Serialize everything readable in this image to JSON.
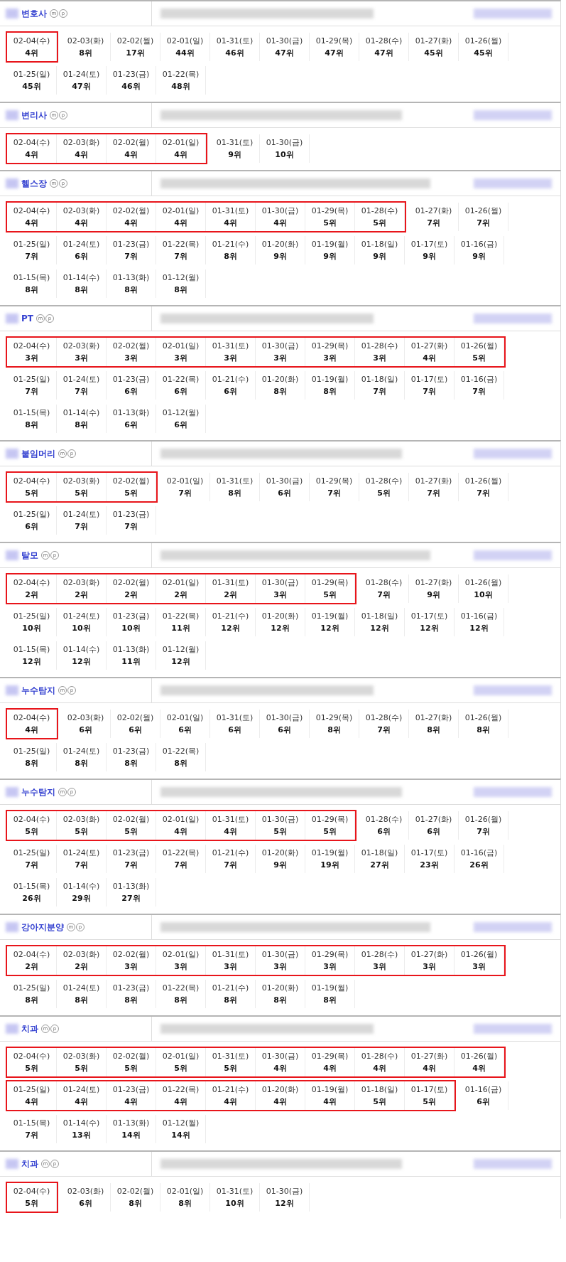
{
  "sections": [
    {
      "keyword": "변호사",
      "badges": [
        "m",
        "p"
      ],
      "rows": [
        [
          {
            "highlighted": true,
            "cells": [
              {
                "date": "02-04(수)",
                "rank": "4위"
              }
            ]
          },
          {
            "highlighted": false,
            "cells": [
              {
                "date": "02-03(화)",
                "rank": "8위"
              },
              {
                "date": "02-02(월)",
                "rank": "17위"
              },
              {
                "date": "02-01(일)",
                "rank": "44위"
              },
              {
                "date": "01-31(토)",
                "rank": "46위"
              },
              {
                "date": "01-30(금)",
                "rank": "47위"
              },
              {
                "date": "01-29(목)",
                "rank": "47위"
              },
              {
                "date": "01-28(수)",
                "rank": "47위"
              },
              {
                "date": "01-27(화)",
                "rank": "45위"
              },
              {
                "date": "01-26(월)",
                "rank": "45위"
              }
            ]
          }
        ],
        [
          {
            "highlighted": false,
            "cells": [
              {
                "date": "01-25(일)",
                "rank": "45위"
              },
              {
                "date": "01-24(토)",
                "rank": "47위"
              },
              {
                "date": "01-23(금)",
                "rank": "46위"
              },
              {
                "date": "01-22(목)",
                "rank": "48위"
              }
            ]
          }
        ]
      ]
    },
    {
      "keyword": "변리사",
      "badges": [
        "m",
        "p"
      ],
      "rows": [
        [
          {
            "highlighted": true,
            "cells": [
              {
                "date": "02-04(수)",
                "rank": "4위"
              },
              {
                "date": "02-03(화)",
                "rank": "4위"
              },
              {
                "date": "02-02(월)",
                "rank": "4위"
              },
              {
                "date": "02-01(일)",
                "rank": "4위"
              }
            ]
          },
          {
            "highlighted": false,
            "cells": [
              {
                "date": "01-31(토)",
                "rank": "9위"
              },
              {
                "date": "01-30(금)",
                "rank": "10위"
              }
            ]
          }
        ]
      ]
    },
    {
      "keyword": "헬스장",
      "badges": [
        "m",
        "p"
      ],
      "rows": [
        [
          {
            "highlighted": true,
            "cells": [
              {
                "date": "02-04(수)",
                "rank": "4위"
              },
              {
                "date": "02-03(화)",
                "rank": "4위"
              },
              {
                "date": "02-02(월)",
                "rank": "4위"
              },
              {
                "date": "02-01(일)",
                "rank": "4위"
              },
              {
                "date": "01-31(토)",
                "rank": "4위"
              },
              {
                "date": "01-30(금)",
                "rank": "4위"
              },
              {
                "date": "01-29(목)",
                "rank": "5위"
              },
              {
                "date": "01-28(수)",
                "rank": "5위"
              }
            ]
          },
          {
            "highlighted": false,
            "cells": [
              {
                "date": "01-27(화)",
                "rank": "7위"
              },
              {
                "date": "01-26(월)",
                "rank": "7위"
              }
            ]
          }
        ],
        [
          {
            "highlighted": false,
            "cells": [
              {
                "date": "01-25(일)",
                "rank": "7위"
              },
              {
                "date": "01-24(토)",
                "rank": "6위"
              },
              {
                "date": "01-23(금)",
                "rank": "7위"
              },
              {
                "date": "01-22(목)",
                "rank": "7위"
              },
              {
                "date": "01-21(수)",
                "rank": "8위"
              },
              {
                "date": "01-20(화)",
                "rank": "9위"
              },
              {
                "date": "01-19(월)",
                "rank": "9위"
              },
              {
                "date": "01-18(일)",
                "rank": "9위"
              },
              {
                "date": "01-17(토)",
                "rank": "9위"
              },
              {
                "date": "01-16(금)",
                "rank": "9위"
              }
            ]
          }
        ],
        [
          {
            "highlighted": false,
            "cells": [
              {
                "date": "01-15(목)",
                "rank": "8위"
              },
              {
                "date": "01-14(수)",
                "rank": "8위"
              },
              {
                "date": "01-13(화)",
                "rank": "8위"
              },
              {
                "date": "01-12(월)",
                "rank": "8위"
              }
            ]
          }
        ]
      ]
    },
    {
      "keyword": "PT",
      "badges": [
        "m",
        "p"
      ],
      "rows": [
        [
          {
            "highlighted": true,
            "cells": [
              {
                "date": "02-04(수)",
                "rank": "3위"
              },
              {
                "date": "02-03(화)",
                "rank": "3위"
              },
              {
                "date": "02-02(월)",
                "rank": "3위"
              },
              {
                "date": "02-01(일)",
                "rank": "3위"
              },
              {
                "date": "01-31(토)",
                "rank": "3위"
              },
              {
                "date": "01-30(금)",
                "rank": "3위"
              },
              {
                "date": "01-29(목)",
                "rank": "3위"
              },
              {
                "date": "01-28(수)",
                "rank": "3위"
              },
              {
                "date": "01-27(화)",
                "rank": "4위"
              },
              {
                "date": "01-26(월)",
                "rank": "5위"
              }
            ]
          }
        ],
        [
          {
            "highlighted": false,
            "cells": [
              {
                "date": "01-25(일)",
                "rank": "7위"
              },
              {
                "date": "01-24(토)",
                "rank": "7위"
              },
              {
                "date": "01-23(금)",
                "rank": "6위"
              },
              {
                "date": "01-22(목)",
                "rank": "6위"
              },
              {
                "date": "01-21(수)",
                "rank": "6위"
              },
              {
                "date": "01-20(화)",
                "rank": "8위"
              },
              {
                "date": "01-19(월)",
                "rank": "8위"
              },
              {
                "date": "01-18(일)",
                "rank": "7위"
              },
              {
                "date": "01-17(토)",
                "rank": "7위"
              },
              {
                "date": "01-16(금)",
                "rank": "7위"
              }
            ]
          }
        ],
        [
          {
            "highlighted": false,
            "cells": [
              {
                "date": "01-15(목)",
                "rank": "8위"
              },
              {
                "date": "01-14(수)",
                "rank": "8위"
              },
              {
                "date": "01-13(화)",
                "rank": "6위"
              },
              {
                "date": "01-12(월)",
                "rank": "6위"
              }
            ]
          }
        ]
      ]
    },
    {
      "keyword": "붙임머리",
      "badges": [
        "m",
        "p"
      ],
      "rows": [
        [
          {
            "highlighted": true,
            "cells": [
              {
                "date": "02-04(수)",
                "rank": "5위"
              },
              {
                "date": "02-03(화)",
                "rank": "5위"
              },
              {
                "date": "02-02(월)",
                "rank": "5위"
              }
            ]
          },
          {
            "highlighted": false,
            "cells": [
              {
                "date": "02-01(일)",
                "rank": "7위"
              },
              {
                "date": "01-31(토)",
                "rank": "8위"
              },
              {
                "date": "01-30(금)",
                "rank": "6위"
              },
              {
                "date": "01-29(목)",
                "rank": "7위"
              },
              {
                "date": "01-28(수)",
                "rank": "5위"
              },
              {
                "date": "01-27(화)",
                "rank": "7위"
              },
              {
                "date": "01-26(월)",
                "rank": "7위"
              }
            ]
          }
        ],
        [
          {
            "highlighted": false,
            "cells": [
              {
                "date": "01-25(일)",
                "rank": "6위"
              },
              {
                "date": "01-24(토)",
                "rank": "7위"
              },
              {
                "date": "01-23(금)",
                "rank": "7위"
              }
            ]
          }
        ]
      ]
    },
    {
      "keyword": "탈모",
      "badges": [
        "m",
        "p"
      ],
      "rows": [
        [
          {
            "highlighted": true,
            "cells": [
              {
                "date": "02-04(수)",
                "rank": "2위"
              },
              {
                "date": "02-03(화)",
                "rank": "2위"
              },
              {
                "date": "02-02(월)",
                "rank": "2위"
              },
              {
                "date": "02-01(일)",
                "rank": "2위"
              },
              {
                "date": "01-31(토)",
                "rank": "2위"
              },
              {
                "date": "01-30(금)",
                "rank": "3위"
              },
              {
                "date": "01-29(목)",
                "rank": "5위"
              }
            ]
          },
          {
            "highlighted": false,
            "cells": [
              {
                "date": "01-28(수)",
                "rank": "7위"
              },
              {
                "date": "01-27(화)",
                "rank": "9위"
              },
              {
                "date": "01-26(월)",
                "rank": "10위"
              }
            ]
          }
        ],
        [
          {
            "highlighted": false,
            "cells": [
              {
                "date": "01-25(일)",
                "rank": "10위"
              },
              {
                "date": "01-24(토)",
                "rank": "10위"
              },
              {
                "date": "01-23(금)",
                "rank": "10위"
              },
              {
                "date": "01-22(목)",
                "rank": "11위"
              },
              {
                "date": "01-21(수)",
                "rank": "12위"
              },
              {
                "date": "01-20(화)",
                "rank": "12위"
              },
              {
                "date": "01-19(월)",
                "rank": "12위"
              },
              {
                "date": "01-18(일)",
                "rank": "12위"
              },
              {
                "date": "01-17(토)",
                "rank": "12위"
              },
              {
                "date": "01-16(금)",
                "rank": "12위"
              }
            ]
          }
        ],
        [
          {
            "highlighted": false,
            "cells": [
              {
                "date": "01-15(목)",
                "rank": "12위"
              },
              {
                "date": "01-14(수)",
                "rank": "12위"
              },
              {
                "date": "01-13(화)",
                "rank": "11위"
              },
              {
                "date": "01-12(월)",
                "rank": "12위"
              }
            ]
          }
        ]
      ]
    },
    {
      "keyword": "누수탐지",
      "badges": [
        "m",
        "p"
      ],
      "rows": [
        [
          {
            "highlighted": true,
            "cells": [
              {
                "date": "02-04(수)",
                "rank": "4위"
              }
            ]
          },
          {
            "highlighted": false,
            "cells": [
              {
                "date": "02-03(화)",
                "rank": "6위"
              },
              {
                "date": "02-02(월)",
                "rank": "6위"
              },
              {
                "date": "02-01(일)",
                "rank": "6위"
              },
              {
                "date": "01-31(토)",
                "rank": "6위"
              },
              {
                "date": "01-30(금)",
                "rank": "6위"
              },
              {
                "date": "01-29(목)",
                "rank": "8위"
              },
              {
                "date": "01-28(수)",
                "rank": "7위"
              },
              {
                "date": "01-27(화)",
                "rank": "8위"
              },
              {
                "date": "01-26(월)",
                "rank": "8위"
              }
            ]
          }
        ],
        [
          {
            "highlighted": false,
            "cells": [
              {
                "date": "01-25(일)",
                "rank": "8위"
              },
              {
                "date": "01-24(토)",
                "rank": "8위"
              },
              {
                "date": "01-23(금)",
                "rank": "8위"
              },
              {
                "date": "01-22(목)",
                "rank": "8위"
              }
            ]
          }
        ]
      ]
    },
    {
      "keyword": "누수탐지",
      "badges": [
        "m",
        "p"
      ],
      "rows": [
        [
          {
            "highlighted": true,
            "cells": [
              {
                "date": "02-04(수)",
                "rank": "5위"
              },
              {
                "date": "02-03(화)",
                "rank": "5위"
              },
              {
                "date": "02-02(월)",
                "rank": "5위"
              },
              {
                "date": "02-01(일)",
                "rank": "4위"
              },
              {
                "date": "01-31(토)",
                "rank": "4위"
              },
              {
                "date": "01-30(금)",
                "rank": "5위"
              },
              {
                "date": "01-29(목)",
                "rank": "5위"
              }
            ]
          },
          {
            "highlighted": false,
            "cells": [
              {
                "date": "01-28(수)",
                "rank": "6위"
              },
              {
                "date": "01-27(화)",
                "rank": "6위"
              },
              {
                "date": "01-26(월)",
                "rank": "7위"
              }
            ]
          }
        ],
        [
          {
            "highlighted": false,
            "cells": [
              {
                "date": "01-25(일)",
                "rank": "7위"
              },
              {
                "date": "01-24(토)",
                "rank": "7위"
              },
              {
                "date": "01-23(금)",
                "rank": "7위"
              },
              {
                "date": "01-22(목)",
                "rank": "7위"
              },
              {
                "date": "01-21(수)",
                "rank": "7위"
              },
              {
                "date": "01-20(화)",
                "rank": "9위"
              },
              {
                "date": "01-19(월)",
                "rank": "19위"
              },
              {
                "date": "01-18(일)",
                "rank": "27위"
              },
              {
                "date": "01-17(토)",
                "rank": "23위"
              },
              {
                "date": "01-16(금)",
                "rank": "26위"
              }
            ]
          }
        ],
        [
          {
            "highlighted": false,
            "cells": [
              {
                "date": "01-15(목)",
                "rank": "26위"
              },
              {
                "date": "01-14(수)",
                "rank": "29위"
              },
              {
                "date": "01-13(화)",
                "rank": "27위"
              }
            ]
          }
        ]
      ]
    },
    {
      "keyword": "강아지분양",
      "badges": [
        "m",
        "p"
      ],
      "rows": [
        [
          {
            "highlighted": true,
            "cells": [
              {
                "date": "02-04(수)",
                "rank": "2위"
              },
              {
                "date": "02-03(화)",
                "rank": "2위"
              },
              {
                "date": "02-02(월)",
                "rank": "3위"
              },
              {
                "date": "02-01(일)",
                "rank": "3위"
              },
              {
                "date": "01-31(토)",
                "rank": "3위"
              },
              {
                "date": "01-30(금)",
                "rank": "3위"
              },
              {
                "date": "01-29(목)",
                "rank": "3위"
              },
              {
                "date": "01-28(수)",
                "rank": "3위"
              },
              {
                "date": "01-27(화)",
                "rank": "3위"
              },
              {
                "date": "01-26(월)",
                "rank": "3위"
              }
            ]
          }
        ],
        [
          {
            "highlighted": false,
            "cells": [
              {
                "date": "01-25(일)",
                "rank": "8위"
              },
              {
                "date": "01-24(토)",
                "rank": "8위"
              },
              {
                "date": "01-23(금)",
                "rank": "8위"
              },
              {
                "date": "01-22(목)",
                "rank": "8위"
              },
              {
                "date": "01-21(수)",
                "rank": "8위"
              },
              {
                "date": "01-20(화)",
                "rank": "8위"
              },
              {
                "date": "01-19(월)",
                "rank": "8위"
              }
            ]
          }
        ]
      ]
    },
    {
      "keyword": "치과",
      "badges": [
        "m",
        "p"
      ],
      "rows": [
        [
          {
            "highlighted": true,
            "cells": [
              {
                "date": "02-04(수)",
                "rank": "5위"
              },
              {
                "date": "02-03(화)",
                "rank": "5위"
              },
              {
                "date": "02-02(월)",
                "rank": "5위"
              },
              {
                "date": "02-01(일)",
                "rank": "5위"
              },
              {
                "date": "01-31(토)",
                "rank": "5위"
              },
              {
                "date": "01-30(금)",
                "rank": "4위"
              },
              {
                "date": "01-29(목)",
                "rank": "4위"
              },
              {
                "date": "01-28(수)",
                "rank": "4위"
              },
              {
                "date": "01-27(화)",
                "rank": "4위"
              },
              {
                "date": "01-26(월)",
                "rank": "4위"
              }
            ]
          }
        ],
        [
          {
            "highlighted": true,
            "cells": [
              {
                "date": "01-25(일)",
                "rank": "4위"
              },
              {
                "date": "01-24(토)",
                "rank": "4위"
              },
              {
                "date": "01-23(금)",
                "rank": "4위"
              },
              {
                "date": "01-22(목)",
                "rank": "4위"
              },
              {
                "date": "01-21(수)",
                "rank": "4위"
              },
              {
                "date": "01-20(화)",
                "rank": "4위"
              },
              {
                "date": "01-19(월)",
                "rank": "4위"
              },
              {
                "date": "01-18(일)",
                "rank": "5위"
              },
              {
                "date": "01-17(토)",
                "rank": "5위"
              }
            ]
          },
          {
            "highlighted": false,
            "cells": [
              {
                "date": "01-16(금)",
                "rank": "6위"
              }
            ]
          }
        ],
        [
          {
            "highlighted": false,
            "cells": [
              {
                "date": "01-15(목)",
                "rank": "7위"
              },
              {
                "date": "01-14(수)",
                "rank": "13위"
              },
              {
                "date": "01-13(화)",
                "rank": "14위"
              },
              {
                "date": "01-12(월)",
                "rank": "14위"
              }
            ]
          }
        ]
      ]
    },
    {
      "keyword": "치과",
      "badges": [
        "m",
        "p"
      ],
      "rows": [
        [
          {
            "highlighted": true,
            "cells": [
              {
                "date": "02-04(수)",
                "rank": "5위"
              }
            ]
          },
          {
            "highlighted": false,
            "cells": [
              {
                "date": "02-03(화)",
                "rank": "6위"
              },
              {
                "date": "02-02(월)",
                "rank": "8위"
              },
              {
                "date": "02-01(일)",
                "rank": "8위"
              },
              {
                "date": "01-31(토)",
                "rank": "10위"
              },
              {
                "date": "01-30(금)",
                "rank": "12위"
              }
            ]
          }
        ]
      ]
    }
  ]
}
